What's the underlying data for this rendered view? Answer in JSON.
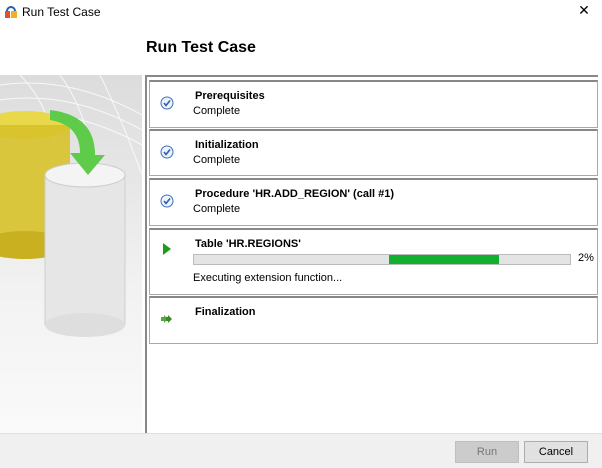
{
  "window": {
    "title": "Run Test Case",
    "close_glyph": "✕"
  },
  "heading": "Run Test Case",
  "steps": [
    {
      "name": "Prerequisites",
      "status": "Complete",
      "icon": "check-circle-icon"
    },
    {
      "name": "Initialization",
      "status": "Complete",
      "icon": "check-circle-icon"
    },
    {
      "name": "Procedure 'HR.ADD_REGION' (call #1)",
      "status": "Complete",
      "icon": "check-circle-icon"
    },
    {
      "name": "Table 'HR.REGIONS'",
      "status": "Executing extension function...",
      "icon": "play-icon",
      "progress_text": "2%",
      "progress": 2
    },
    {
      "name": "Finalization",
      "icon": "double-arrow-icon"
    }
  ],
  "buttons": {
    "run": "Run",
    "cancel": "Cancel"
  },
  "colors": {
    "progress": "#11b02e",
    "check": "#3a6fc4"
  }
}
